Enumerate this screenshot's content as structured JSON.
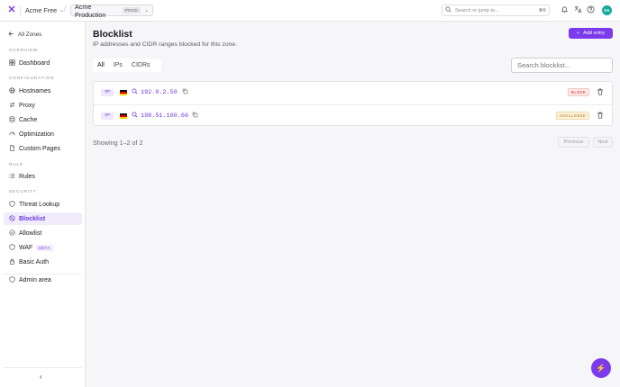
{
  "topbar": {
    "account": "Acme Free",
    "zone": "Acme Production",
    "zone_badge": "PROD",
    "search_placeholder": "Search or jump to...",
    "search_shortcut": "⌘K",
    "avatar_initials": "DA"
  },
  "sidebar": {
    "back_label": "All Zones",
    "sections": {
      "overview": "OVERVIEW",
      "configuration": "CONFIGURATION",
      "rule": "RULE",
      "security": "SECURITY"
    },
    "items": {
      "dashboard": "Dashboard",
      "hostnames": "Hostnames",
      "proxy": "Proxy",
      "cache": "Cache",
      "optimization": "Optimization",
      "custom_pages": "Custom Pages",
      "rules": "Rules",
      "threat_lookup": "Threat Lookup",
      "blocklist": "Blocklist",
      "allowlist": "Allowlist",
      "waf": "WAF",
      "waf_badge": "BETA",
      "basic_auth": "Basic Auth",
      "admin_area": "Admin area"
    }
  },
  "main": {
    "title": "Blocklist",
    "subtitle": "IP addresses and CIDR ranges blocked for this zone.",
    "add_label": "Add entry",
    "tabs": [
      "All",
      "IPs",
      "CIDRs"
    ],
    "filter_placeholder": "Search blocklist...",
    "rows": [
      {
        "type": "IP",
        "value": "192.0.2.50",
        "action": "BLOCK"
      },
      {
        "type": "IP",
        "value": "198.51.100.66",
        "action": "CHALLENGE"
      }
    ],
    "showing": "Showing 1–2 of 2",
    "prev_label": "Previous",
    "next_label": "Next"
  },
  "colors": {
    "accent": "#7c3aed",
    "block": "#d12b2b",
    "challenge": "#b9770f"
  }
}
